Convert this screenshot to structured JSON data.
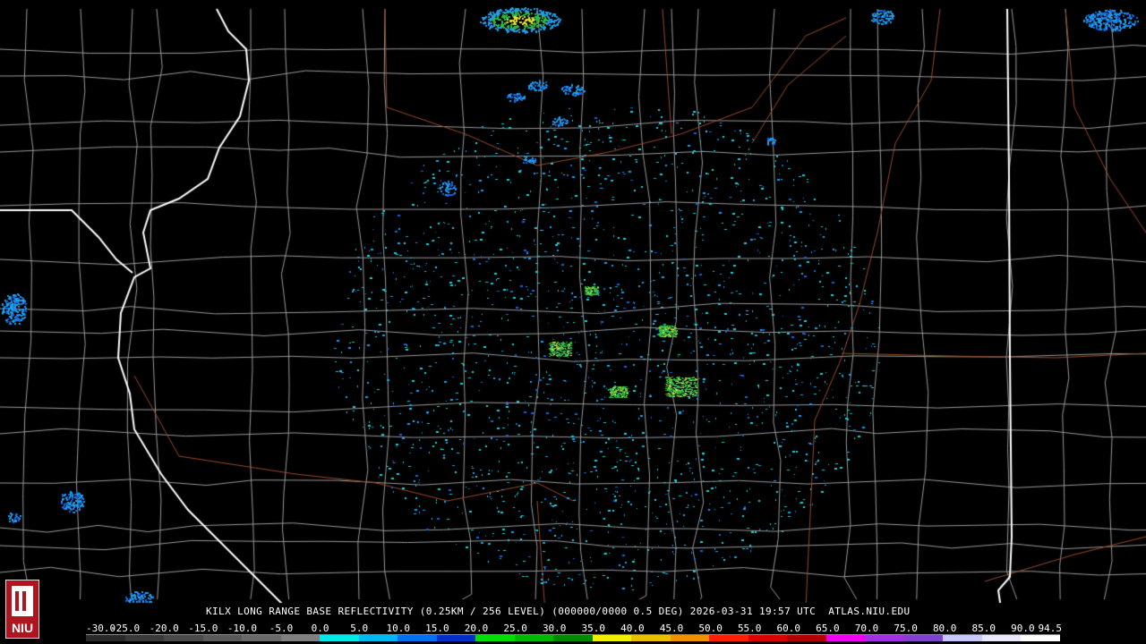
{
  "product": {
    "caption": "KILX LONG RANGE BASE REFLECTIVITY (0.25KM / 256 LEVEL) (000000/0000 0.5 DEG) 2026-03-31 19:57 UTC  ATLAS.NIU.EDU"
  },
  "logo": {
    "text": "NIU",
    "icon": "niu-tower-logo-icon"
  },
  "scale": {
    "labels": [
      "-30.0",
      "-25.0",
      "-20.0",
      "-15.0",
      "-10.0",
      "-5.0",
      "0.0",
      "5.0",
      "10.0",
      "15.0",
      "20.0",
      "25.0",
      "30.0",
      "35.0",
      "40.0",
      "45.0",
      "50.0",
      "55.0",
      "60.0",
      "65.0",
      "70.0",
      "75.0",
      "80.0",
      "85.0",
      "90.0",
      "94.5"
    ],
    "colors": [
      "#2a2a2a",
      "#3a3a3a",
      "#4a4a4a",
      "#5a5a5a",
      "#6a6a6a",
      "#808080",
      "#00e8e8",
      "#00b8f0",
      "#0070f0",
      "#0030c8",
      "#00e000",
      "#00b800",
      "#008800",
      "#f0f000",
      "#e8c000",
      "#f09000",
      "#ff2000",
      "#d80000",
      "#b00000",
      "#f000f0",
      "#a030e0",
      "#8040d0",
      "#c8c8ff",
      "#e8e8ff",
      "#ffffff"
    ]
  },
  "map": {
    "colors": {
      "background": "#000000",
      "county_lines": "#9a9a9a",
      "state_lines": "#ffffff",
      "highways": "#9a4a2a",
      "echo_light": "#19d3df",
      "echo_mid": "#1aa0ef",
      "echo_strong": "#1565e0",
      "echo_green": "#2fb84a",
      "echo_yellow": "#e8e020",
      "radar_site": "#000000"
    }
  }
}
